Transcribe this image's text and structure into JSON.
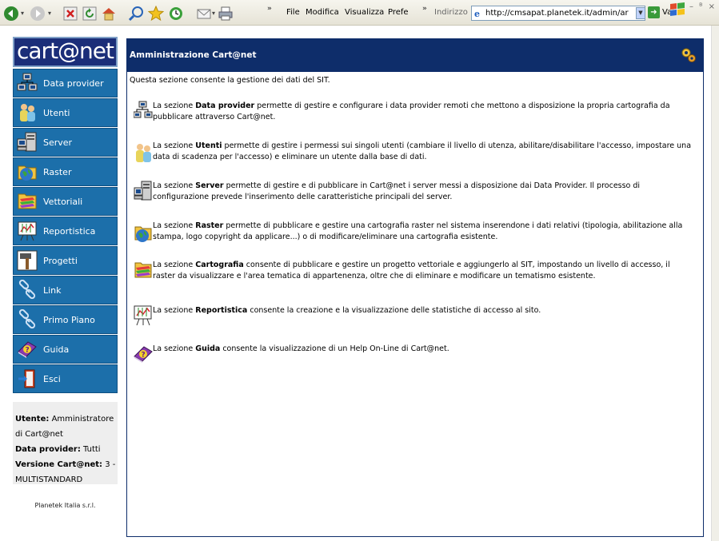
{
  "browser": {
    "menu": [
      "File",
      "Modifica",
      "Visualizza",
      "Prefe"
    ],
    "address_label": "Indirizzo",
    "address": "http://cmsapat.planetek.it/admin/ar",
    "go_label": "Vai"
  },
  "logo": "cart@net",
  "nav": [
    {
      "label": "Data provider",
      "icon": "network-computers-icon"
    },
    {
      "label": "Utenti",
      "icon": "users-icon"
    },
    {
      "label": "Server",
      "icon": "server-icon"
    },
    {
      "label": "Raster",
      "icon": "globe-folder-icon"
    },
    {
      "label": "Vettoriali",
      "icon": "layers-folder-icon"
    },
    {
      "label": "Reportistica",
      "icon": "chart-board-icon"
    },
    {
      "label": "Progetti",
      "icon": "hammer-icon"
    },
    {
      "label": "Link",
      "icon": "link-icon"
    },
    {
      "label": "Primo Piano",
      "icon": "link-icon"
    },
    {
      "label": "Guida",
      "icon": "help-book-icon"
    },
    {
      "label": "Esci",
      "icon": "exit-door-icon"
    }
  ],
  "info": {
    "user_label": "Utente:",
    "user_value": "Amministratore di Cart@net",
    "dp_label": "Data provider:",
    "dp_value": "Tutti",
    "ver_label": "Versione Cart@net:",
    "ver_value": "3 - MULTISTANDARD"
  },
  "company": "Planetek Italia s.r.l.",
  "panel": {
    "title": "Amministrazione Cart@net",
    "intro": "Questa sezione consente la gestione dei dati del SIT.",
    "sections": [
      {
        "pre": "La sezione ",
        "name": "Data provider",
        "text": " permette di gestire e configurare i data provider remoti che mettono a disposizione la propria cartografia da pubblicare attraverso Cart@net."
      },
      {
        "pre": "La sezione ",
        "name": "Utenti",
        "text": " permette di gestire i permessi sui singoli utenti (cambiare il livello di utenza, abilitare/disabilitare l'accesso, impostare una data di scadenza per l'accesso) e eliminare un utente dalla base di dati."
      },
      {
        "pre": "La sezione ",
        "name": "Server",
        "text": " permette di gestire e di pubblicare in Cart@net i server messi a disposizione dai Data Provider. Il processo di configurazione prevede l'inserimento delle caratteristiche principali del server."
      },
      {
        "pre": "La sezione ",
        "name": "Raster",
        "text": " permette di pubblicare e gestire una cartografia raster nel sistema inserendone i dati relativi (tipologia, abilitazione alla stampa, logo copyright da applicare...) o di modificare/eliminare una cartografia esistente."
      },
      {
        "pre": "La sezione ",
        "name": "Cartografia",
        "text": " consente di pubblicare e gestire un progetto vettoriale e aggiungerlo al SIT, impostando un livello di accesso, il raster da visualizzare e l'area tematica di appartenenza, oltre che di eliminare e modificare un tematismo esistente."
      },
      {
        "pre": "La sezione ",
        "name": "Reportistica",
        "text": " consente la creazione e la visualizzazione delle statistiche di accesso al sito."
      },
      {
        "pre": "La sezione ",
        "name": "Guida",
        "text": " consente la visualizzazione di un Help On-Line di Cart@net."
      }
    ]
  }
}
